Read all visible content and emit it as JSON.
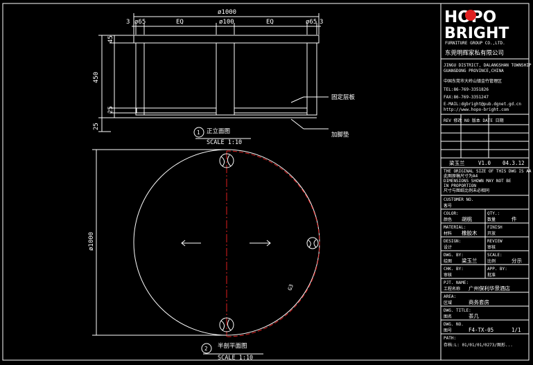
{
  "drawing": {
    "elevation": {
      "dims": {
        "end_left": "3",
        "end_right": "3",
        "leg_left": "ø65",
        "eq_left": "EQ",
        "center": "ø100",
        "eq_right": "EQ",
        "leg_right": "ø65",
        "overall": "ø1000",
        "top_thk": "45",
        "height": "450",
        "shelf_thk": "25",
        "foot": "25"
      },
      "callouts": {
        "shelf": "固定层板",
        "foot": "加脚垫"
      },
      "title": {
        "num": "1",
        "name": "正立面图",
        "scale": "SCALE 1:10"
      }
    },
    "plan": {
      "diameter": "ø1000",
      "seam_tag": "G3",
      "title": {
        "num": "2",
        "name": "半剖平面图",
        "scale": "SCALE 1:10"
      }
    }
  },
  "title_block": {
    "logo_line1": "HOPO",
    "logo_line2": "BRIGHT",
    "logo_sub": "FURNITURE GROUP CO.,LTD.",
    "company_cn": "东莞明辉家私有限公司",
    "addr_en": [
      "JINGU DISTRICT, DALANGSHAN TOWNSHIP",
      "GUANGDONG PROVINCE,CHINA"
    ],
    "addr_cn": "中国东莞市大岭山镇金竹管理区",
    "tel": "TEL:86-769-3351826",
    "fax": "FAX:86-769-3351247",
    "email": "E-MAIL:dgbright@pub.dgnet.gd.cn",
    "web": "http://www.hopo-bright.com",
    "rev_header": "REV 修改    NO 版本    DATE 日期",
    "designer": "梁玉兰",
    "version": "V1.0",
    "rev_date": "04.3.12",
    "notes": [
      "THE ORIGINAL SIZE OF THIS DWG IS AA",
      "此图原稿尺寸为A4",
      "DIMENSIONS SHOWN MAY NOT BE",
      "IN PROPORTION",
      "尺寸与图纸比例未必相同"
    ],
    "rows": [
      {
        "en": "CUSTOMER NO.",
        "cn": "客号",
        "value": ""
      },
      {
        "en": "COLOR:",
        "cn": "颜色",
        "value": "胡桃",
        "en2": "QTY.:",
        "cn2": "数量",
        "value2": "件"
      },
      {
        "en": "MATERIAL:",
        "cn": "材料",
        "value": "橡胶木",
        "en2": "FINISH",
        "cn2": "开放",
        "value2": ""
      },
      {
        "en": "DESIGN:",
        "cn": "设计",
        "value": "",
        "en2": "REVIEW",
        "cn2": "审核",
        "value2": ""
      },
      {
        "en": "DWG. BY:",
        "cn": "绘图",
        "value": "梁玉兰",
        "en2": "SCALE:",
        "cn2": "比例",
        "value2": "分示"
      },
      {
        "en": "CHK. BY:",
        "cn": "审核",
        "value": "",
        "en2": "APP. BY:",
        "cn2": "批准",
        "value2": ""
      },
      {
        "en": "PJT. NAME:",
        "cn": "工程名称",
        "value": "广州保利华景酒店",
        "en2": "",
        "cn2": "",
        "value2": ""
      },
      {
        "en": "AREA:",
        "cn": "区域",
        "value": "商务套房",
        "en2": "",
        "cn2": "",
        "value2": ""
      },
      {
        "en": "DWG. TITLE:",
        "cn": "图名",
        "value": "茶几",
        "en2": "",
        "cn2": "",
        "value2": ""
      },
      {
        "en": "DWG. NO.",
        "cn": "图号",
        "value": "F4-TX-05",
        "en2": "",
        "cn2": "",
        "value2": "1/1"
      },
      {
        "en": "PATH:",
        "cn": "",
        "value": "",
        "en2": "",
        "cn2": "",
        "value2": ""
      }
    ],
    "path": "存档:L: 01/01/01/0273/图形..."
  }
}
